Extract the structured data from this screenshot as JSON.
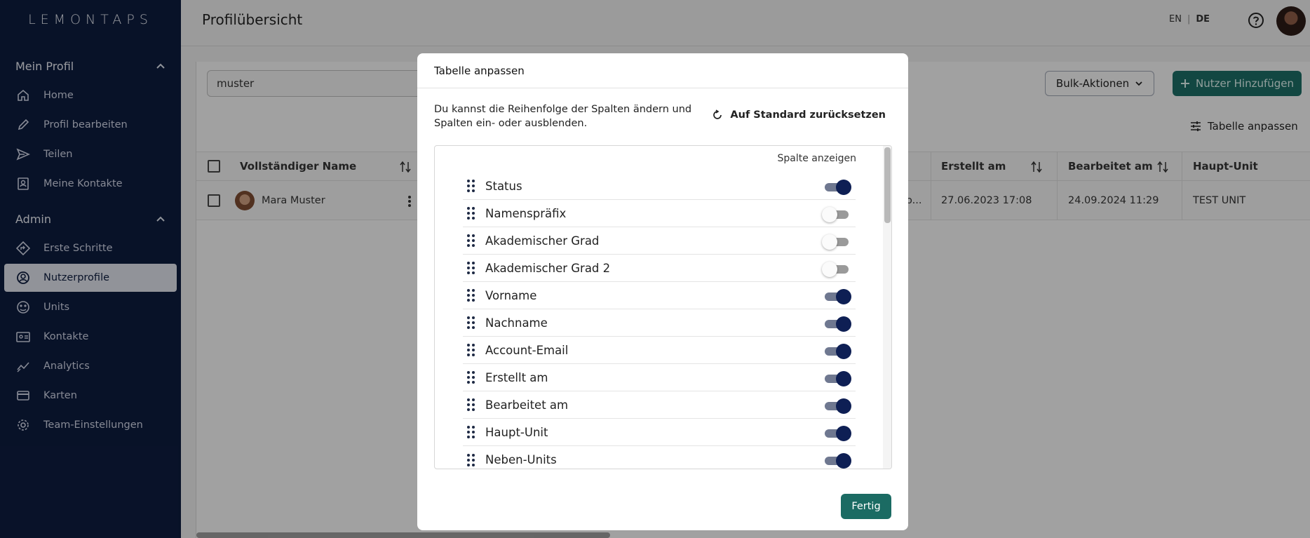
{
  "brand": "LEMONTAPS",
  "colors": {
    "sidebar_bg": "#0d1b3d",
    "accent": "#1b6b63",
    "toggle_on": "#0e1f54"
  },
  "sidebar": {
    "sections": [
      {
        "title": "Mein Profil",
        "items": [
          {
            "label": "Home",
            "icon": "home-icon"
          },
          {
            "label": "Profil bearbeiten",
            "icon": "pencil-icon"
          },
          {
            "label": "Teilen",
            "icon": "send-icon"
          },
          {
            "label": "Meine Kontakte",
            "icon": "contact-card-icon"
          }
        ]
      },
      {
        "title": "Admin",
        "items": [
          {
            "label": "Erste Schritte",
            "icon": "directions-icon"
          },
          {
            "label": "Nutzerprofile",
            "icon": "user-circle-icon",
            "active": true
          },
          {
            "label": "Units",
            "icon": "units-icon"
          },
          {
            "label": "Kontakte",
            "icon": "contacts-icon"
          },
          {
            "label": "Analytics",
            "icon": "analytics-icon"
          },
          {
            "label": "Karten",
            "icon": "credit-card-icon"
          },
          {
            "label": "Team-Einstellungen",
            "icon": "gear-icon"
          }
        ]
      }
    ]
  },
  "header": {
    "title": "Profilübersicht",
    "lang_en": "EN",
    "lang_sep": "|",
    "lang_de": "DE"
  },
  "main": {
    "search_value": "muster",
    "bulk_label": "Bulk-Aktionen",
    "add_user_label": "Nutzer Hinzufügen",
    "adjust_label": "Tabelle anpassen",
    "columns": {
      "name": "Vollständiger Name",
      "created": "Erstellt am",
      "edited": "Bearbeitet am",
      "unit": "Haupt-Unit"
    },
    "row": {
      "name": "Mara Muster",
      "truncated": "o...",
      "created": "27.06.2023 17:08",
      "edited": "24.09.2024 11:29",
      "unit": "TEST UNIT"
    }
  },
  "modal": {
    "title": "Tabelle anpassen",
    "description": "Du kannst die Reihenfolge der Spalten ändern und Spalten ein- oder ausblenden.",
    "reset_label": "Auf Standard zurücksetzen",
    "column_header": "Spalte anzeigen",
    "done_label": "Fertig",
    "columns": [
      {
        "label": "Status",
        "visible": true
      },
      {
        "label": "Namenspräfix",
        "visible": false
      },
      {
        "label": "Akademischer Grad",
        "visible": false
      },
      {
        "label": "Akademischer Grad 2",
        "visible": false
      },
      {
        "label": "Vorname",
        "visible": true
      },
      {
        "label": "Nachname",
        "visible": true
      },
      {
        "label": "Account-Email",
        "visible": true
      },
      {
        "label": "Erstellt am",
        "visible": true
      },
      {
        "label": "Bearbeitet am",
        "visible": true
      },
      {
        "label": "Haupt-Unit",
        "visible": true
      },
      {
        "label": "Neben-Units",
        "visible": true
      }
    ]
  }
}
